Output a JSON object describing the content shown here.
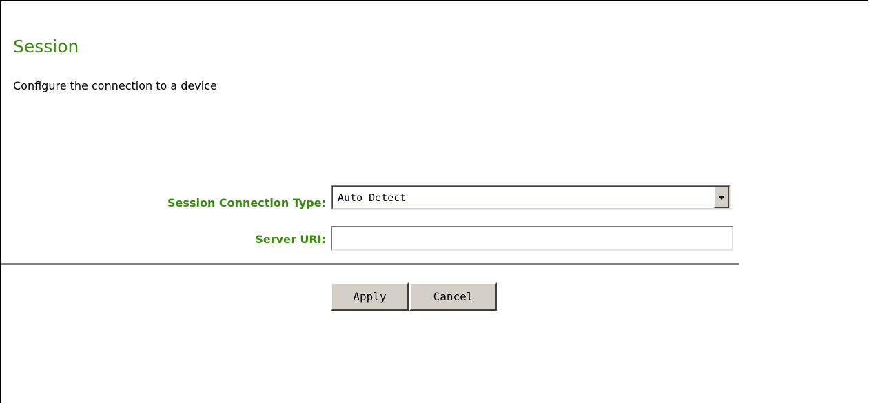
{
  "page": {
    "title": "Session",
    "subtitle": "Configure the connection to a device"
  },
  "form": {
    "connection_type": {
      "label": "Session Connection Type:",
      "selected_value": "Auto Detect"
    },
    "server_uri": {
      "label": "Server URI:",
      "value": "",
      "placeholder": ""
    }
  },
  "buttons": {
    "apply_label": "Apply",
    "cancel_label": "Cancel"
  },
  "colors": {
    "accent": "#3a8a12",
    "button_face": "#d4d0c8"
  }
}
